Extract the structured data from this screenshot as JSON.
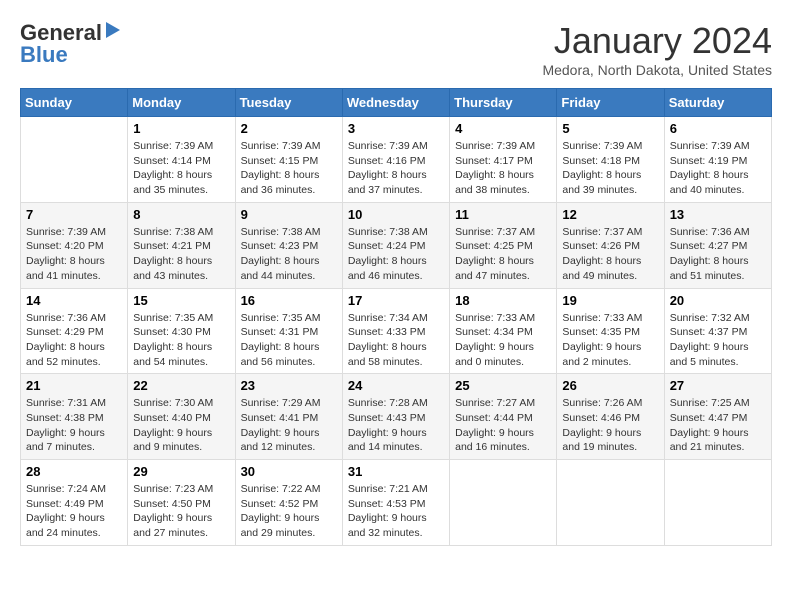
{
  "header": {
    "logo_general": "General",
    "logo_blue": "Blue",
    "month_title": "January 2024",
    "location": "Medora, North Dakota, United States"
  },
  "weekdays": [
    "Sunday",
    "Monday",
    "Tuesday",
    "Wednesday",
    "Thursday",
    "Friday",
    "Saturday"
  ],
  "weeks": [
    {
      "days": [
        {
          "num": "",
          "empty": true
        },
        {
          "num": "1",
          "sunrise": "Sunrise: 7:39 AM",
          "sunset": "Sunset: 4:14 PM",
          "daylight": "Daylight: 8 hours and 35 minutes."
        },
        {
          "num": "2",
          "sunrise": "Sunrise: 7:39 AM",
          "sunset": "Sunset: 4:15 PM",
          "daylight": "Daylight: 8 hours and 36 minutes."
        },
        {
          "num": "3",
          "sunrise": "Sunrise: 7:39 AM",
          "sunset": "Sunset: 4:16 PM",
          "daylight": "Daylight: 8 hours and 37 minutes."
        },
        {
          "num": "4",
          "sunrise": "Sunrise: 7:39 AM",
          "sunset": "Sunset: 4:17 PM",
          "daylight": "Daylight: 8 hours and 38 minutes."
        },
        {
          "num": "5",
          "sunrise": "Sunrise: 7:39 AM",
          "sunset": "Sunset: 4:18 PM",
          "daylight": "Daylight: 8 hours and 39 minutes."
        },
        {
          "num": "6",
          "sunrise": "Sunrise: 7:39 AM",
          "sunset": "Sunset: 4:19 PM",
          "daylight": "Daylight: 8 hours and 40 minutes."
        }
      ]
    },
    {
      "days": [
        {
          "num": "7",
          "sunrise": "Sunrise: 7:39 AM",
          "sunset": "Sunset: 4:20 PM",
          "daylight": "Daylight: 8 hours and 41 minutes."
        },
        {
          "num": "8",
          "sunrise": "Sunrise: 7:38 AM",
          "sunset": "Sunset: 4:21 PM",
          "daylight": "Daylight: 8 hours and 43 minutes."
        },
        {
          "num": "9",
          "sunrise": "Sunrise: 7:38 AM",
          "sunset": "Sunset: 4:23 PM",
          "daylight": "Daylight: 8 hours and 44 minutes."
        },
        {
          "num": "10",
          "sunrise": "Sunrise: 7:38 AM",
          "sunset": "Sunset: 4:24 PM",
          "daylight": "Daylight: 8 hours and 46 minutes."
        },
        {
          "num": "11",
          "sunrise": "Sunrise: 7:37 AM",
          "sunset": "Sunset: 4:25 PM",
          "daylight": "Daylight: 8 hours and 47 minutes."
        },
        {
          "num": "12",
          "sunrise": "Sunrise: 7:37 AM",
          "sunset": "Sunset: 4:26 PM",
          "daylight": "Daylight: 8 hours and 49 minutes."
        },
        {
          "num": "13",
          "sunrise": "Sunrise: 7:36 AM",
          "sunset": "Sunset: 4:27 PM",
          "daylight": "Daylight: 8 hours and 51 minutes."
        }
      ]
    },
    {
      "days": [
        {
          "num": "14",
          "sunrise": "Sunrise: 7:36 AM",
          "sunset": "Sunset: 4:29 PM",
          "daylight": "Daylight: 8 hours and 52 minutes."
        },
        {
          "num": "15",
          "sunrise": "Sunrise: 7:35 AM",
          "sunset": "Sunset: 4:30 PM",
          "daylight": "Daylight: 8 hours and 54 minutes."
        },
        {
          "num": "16",
          "sunrise": "Sunrise: 7:35 AM",
          "sunset": "Sunset: 4:31 PM",
          "daylight": "Daylight: 8 hours and 56 minutes."
        },
        {
          "num": "17",
          "sunrise": "Sunrise: 7:34 AM",
          "sunset": "Sunset: 4:33 PM",
          "daylight": "Daylight: 8 hours and 58 minutes."
        },
        {
          "num": "18",
          "sunrise": "Sunrise: 7:33 AM",
          "sunset": "Sunset: 4:34 PM",
          "daylight": "Daylight: 9 hours and 0 minutes."
        },
        {
          "num": "19",
          "sunrise": "Sunrise: 7:33 AM",
          "sunset": "Sunset: 4:35 PM",
          "daylight": "Daylight: 9 hours and 2 minutes."
        },
        {
          "num": "20",
          "sunrise": "Sunrise: 7:32 AM",
          "sunset": "Sunset: 4:37 PM",
          "daylight": "Daylight: 9 hours and 5 minutes."
        }
      ]
    },
    {
      "days": [
        {
          "num": "21",
          "sunrise": "Sunrise: 7:31 AM",
          "sunset": "Sunset: 4:38 PM",
          "daylight": "Daylight: 9 hours and 7 minutes."
        },
        {
          "num": "22",
          "sunrise": "Sunrise: 7:30 AM",
          "sunset": "Sunset: 4:40 PM",
          "daylight": "Daylight: 9 hours and 9 minutes."
        },
        {
          "num": "23",
          "sunrise": "Sunrise: 7:29 AM",
          "sunset": "Sunset: 4:41 PM",
          "daylight": "Daylight: 9 hours and 12 minutes."
        },
        {
          "num": "24",
          "sunrise": "Sunrise: 7:28 AM",
          "sunset": "Sunset: 4:43 PM",
          "daylight": "Daylight: 9 hours and 14 minutes."
        },
        {
          "num": "25",
          "sunrise": "Sunrise: 7:27 AM",
          "sunset": "Sunset: 4:44 PM",
          "daylight": "Daylight: 9 hours and 16 minutes."
        },
        {
          "num": "26",
          "sunrise": "Sunrise: 7:26 AM",
          "sunset": "Sunset: 4:46 PM",
          "daylight": "Daylight: 9 hours and 19 minutes."
        },
        {
          "num": "27",
          "sunrise": "Sunrise: 7:25 AM",
          "sunset": "Sunset: 4:47 PM",
          "daylight": "Daylight: 9 hours and 21 minutes."
        }
      ]
    },
    {
      "days": [
        {
          "num": "28",
          "sunrise": "Sunrise: 7:24 AM",
          "sunset": "Sunset: 4:49 PM",
          "daylight": "Daylight: 9 hours and 24 minutes."
        },
        {
          "num": "29",
          "sunrise": "Sunrise: 7:23 AM",
          "sunset": "Sunset: 4:50 PM",
          "daylight": "Daylight: 9 hours and 27 minutes."
        },
        {
          "num": "30",
          "sunrise": "Sunrise: 7:22 AM",
          "sunset": "Sunset: 4:52 PM",
          "daylight": "Daylight: 9 hours and 29 minutes."
        },
        {
          "num": "31",
          "sunrise": "Sunrise: 7:21 AM",
          "sunset": "Sunset: 4:53 PM",
          "daylight": "Daylight: 9 hours and 32 minutes."
        },
        {
          "num": "",
          "empty": true
        },
        {
          "num": "",
          "empty": true
        },
        {
          "num": "",
          "empty": true
        }
      ]
    }
  ]
}
